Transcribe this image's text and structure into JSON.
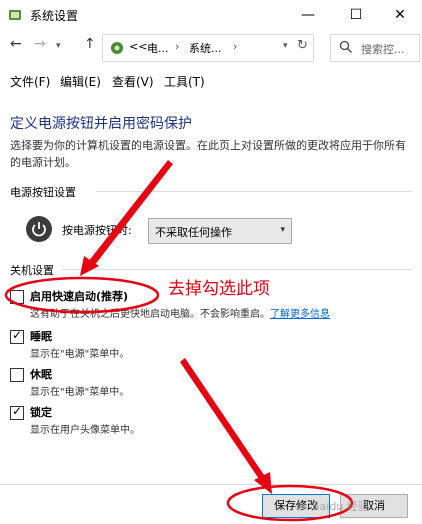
{
  "window": {
    "title": "系统设置",
    "controls": {
      "minimize": "—",
      "maximize": "☐",
      "close": "✕"
    }
  },
  "nav": {
    "history": "<<",
    "crumbs": [
      "电...",
      "系统..."
    ],
    "search_placeholder": "搜索控..."
  },
  "menu": [
    "文件(F)",
    "编辑(E)",
    "查看(V)",
    "工具(T)"
  ],
  "page": {
    "heading": "定义电源按钮并启用密码保护",
    "description": "选择要为你的计算机设置的电源设置。在此页上对设置所做的更改将应用于你所有的电源计划。"
  },
  "power_section": {
    "label": "电源按钮设置",
    "power_button_label": "按电源按钮时:",
    "select_value": "不采取任何操作"
  },
  "shutdown_section": {
    "label": "关机设置",
    "options": [
      {
        "label": "启用快速启动(推荐)",
        "desc": "这有助于在关机之后更快地启动电脑。不会影响重启。",
        "link": "了解更多信息",
        "checked": false
      },
      {
        "label": "睡眠",
        "desc": "显示在\"电源\"菜单中。",
        "checked": true
      },
      {
        "label": "休眠",
        "desc": "显示在\"电源\"菜单中。",
        "checked": false
      },
      {
        "label": "锁定",
        "desc": "显示在用户头像菜单中。",
        "checked": true
      }
    ]
  },
  "buttons": {
    "save": "保存修改",
    "cancel": "取消"
  },
  "annotation": {
    "text": "去掉勾选此项"
  },
  "watermark": "Baidu 经验",
  "colors": {
    "heading": "#1e3287",
    "link": "#0066cc",
    "annotation": "#e60012"
  }
}
